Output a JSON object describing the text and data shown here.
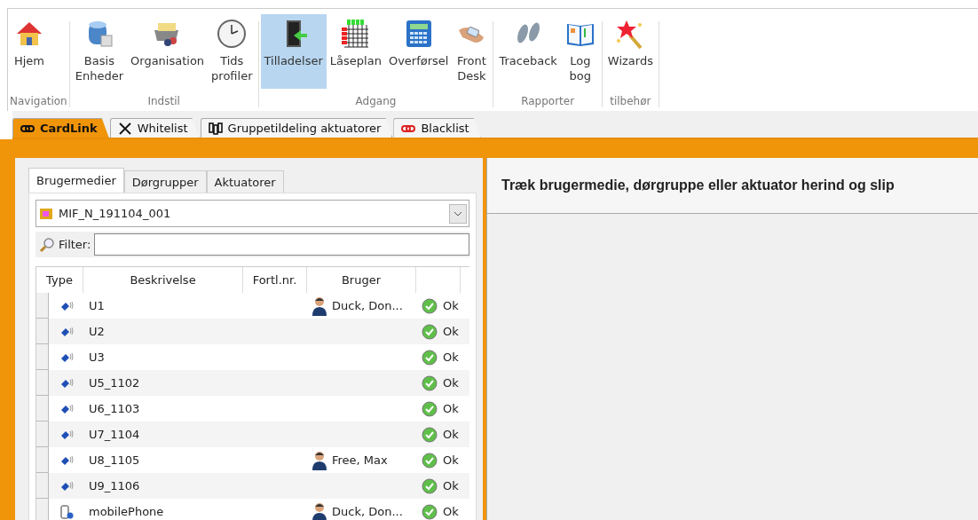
{
  "ribbon": {
    "groups": [
      {
        "label": "Navigation",
        "buttons": [
          {
            "label": "Hjem",
            "selected": false
          }
        ]
      },
      {
        "label": "Indstil",
        "buttons": [
          {
            "label": "Basis\nEnheder",
            "selected": false
          },
          {
            "label": "Organisation",
            "selected": false
          },
          {
            "label": "Tids\nprofiler",
            "selected": false
          }
        ]
      },
      {
        "label": "Adgang",
        "buttons": [
          {
            "label": "Tilladelser",
            "selected": true
          },
          {
            "label": "Låseplan",
            "selected": false
          },
          {
            "label": "Overførsel",
            "selected": false
          },
          {
            "label": "Front\nDesk",
            "selected": false
          }
        ]
      },
      {
        "label": "Rapporter",
        "buttons": [
          {
            "label": "Traceback",
            "selected": false
          },
          {
            "label": "Log\nbog",
            "selected": false
          }
        ]
      },
      {
        "label": "tilbehør",
        "buttons": [
          {
            "label": "Wizards",
            "selected": false
          }
        ]
      }
    ]
  },
  "document_tabs": [
    {
      "label": "CardLink",
      "selected": true
    },
    {
      "label": "Whitelist",
      "selected": false
    },
    {
      "label": "Gruppetildeling aktuatorer",
      "selected": false
    },
    {
      "label": "Blacklist",
      "selected": false
    }
  ],
  "left_panel": {
    "tabs": [
      {
        "label": "Brugermedier",
        "selected": true
      },
      {
        "label": "Dørgrupper",
        "selected": false
      },
      {
        "label": "Aktuatorer",
        "selected": false
      }
    ],
    "combo": {
      "value": "MIF_N_191104_001"
    },
    "filter": {
      "label": "Filter:"
    },
    "table": {
      "columns": [
        "Type",
        "Beskrivelse",
        "Fortl.nr.",
        "Bruger"
      ],
      "rows": [
        {
          "kind": "card",
          "description": "U1",
          "user": "Duck, Don...",
          "status": "Ok"
        },
        {
          "kind": "card",
          "description": "U2",
          "status": "Ok"
        },
        {
          "kind": "card",
          "description": "U3",
          "status": "Ok"
        },
        {
          "kind": "card",
          "description": "U5_1102",
          "status": "Ok"
        },
        {
          "kind": "card",
          "description": "U6_1103",
          "status": "Ok"
        },
        {
          "kind": "card",
          "description": "U7_1104",
          "status": "Ok"
        },
        {
          "kind": "card",
          "description": "U8_1105",
          "user": "Free, Max",
          "status": "Ok"
        },
        {
          "kind": "card",
          "description": "U9_1106",
          "status": "Ok"
        },
        {
          "kind": "phone",
          "description": "mobilePhone",
          "user": "Duck, Don...",
          "status": "Ok"
        }
      ]
    }
  },
  "right_panel": {
    "heading": "Træk brugermedie, dørgruppe eller aktuator herind og slip"
  }
}
